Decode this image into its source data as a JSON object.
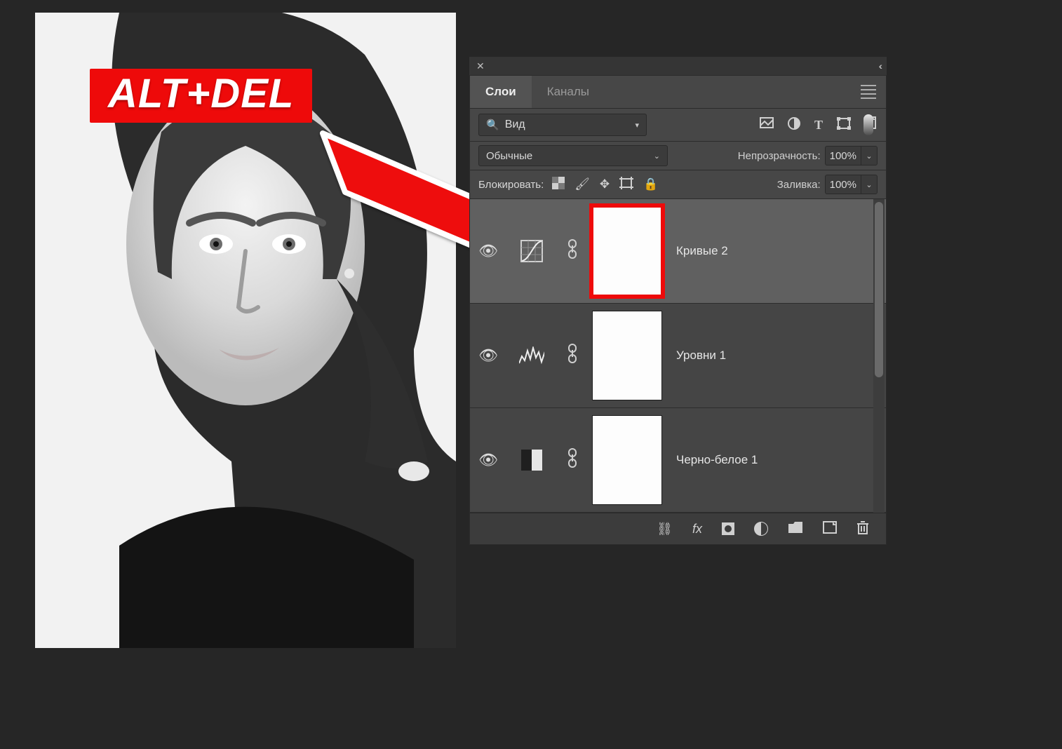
{
  "badge": "ALT+DEL",
  "panel": {
    "tabs": {
      "layers": "Слои",
      "channels": "Каналы"
    },
    "search": {
      "label": "Вид"
    },
    "blend_mode": "Обычные",
    "opacity": {
      "label": "Непрозрачность:",
      "value": "100%"
    },
    "lock_row_label": "Блокировать:",
    "fill": {
      "label": "Заливка:",
      "value": "100%"
    },
    "layers": [
      {
        "name": "Кривые 2",
        "type": "curves",
        "highlight": true,
        "selected": true
      },
      {
        "name": "Уровни 1",
        "type": "levels",
        "highlight": false,
        "selected": false
      },
      {
        "name": "Черно-белое 1",
        "type": "bw",
        "highlight": false,
        "selected": false
      }
    ],
    "footer": {
      "fx": "fx"
    }
  }
}
